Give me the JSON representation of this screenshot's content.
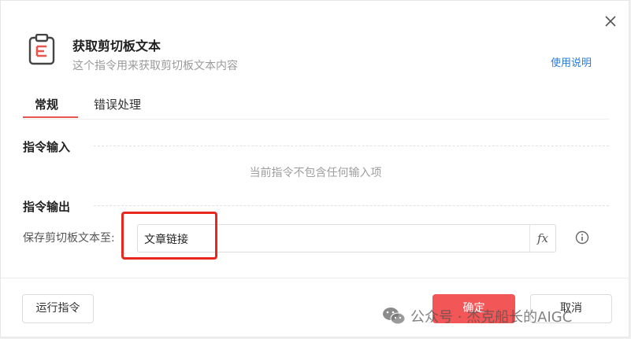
{
  "header": {
    "title": "获取剪切板文本",
    "subtitle": "这个指令用来获取剪切板文本内容",
    "help_link": "使用说明"
  },
  "tabs": [
    {
      "label": "常规",
      "active": true
    },
    {
      "label": "错误处理",
      "active": false
    }
  ],
  "input_section": {
    "title": "指令输入",
    "empty_hint": "当前指令不包含任何输入项"
  },
  "output_section": {
    "title": "指令输出",
    "field_label": "保存剪切板文本至:",
    "field_value": "文章链接",
    "fx_label": "fx"
  },
  "footer": {
    "run_label": "运行指令",
    "ok_label": "确定",
    "cancel_label": "取消"
  },
  "watermark": {
    "text": "公众号 · 杰克船长的AIGC"
  },
  "icons": {
    "close": "close-icon",
    "header": "clipboard-text-icon",
    "info": "info-icon",
    "watermark": "wechat-icon"
  },
  "colors": {
    "accent": "#e8554e",
    "primary_button": "#f25656",
    "link": "#2a7bd6",
    "highlight_box": "#e8281e"
  }
}
